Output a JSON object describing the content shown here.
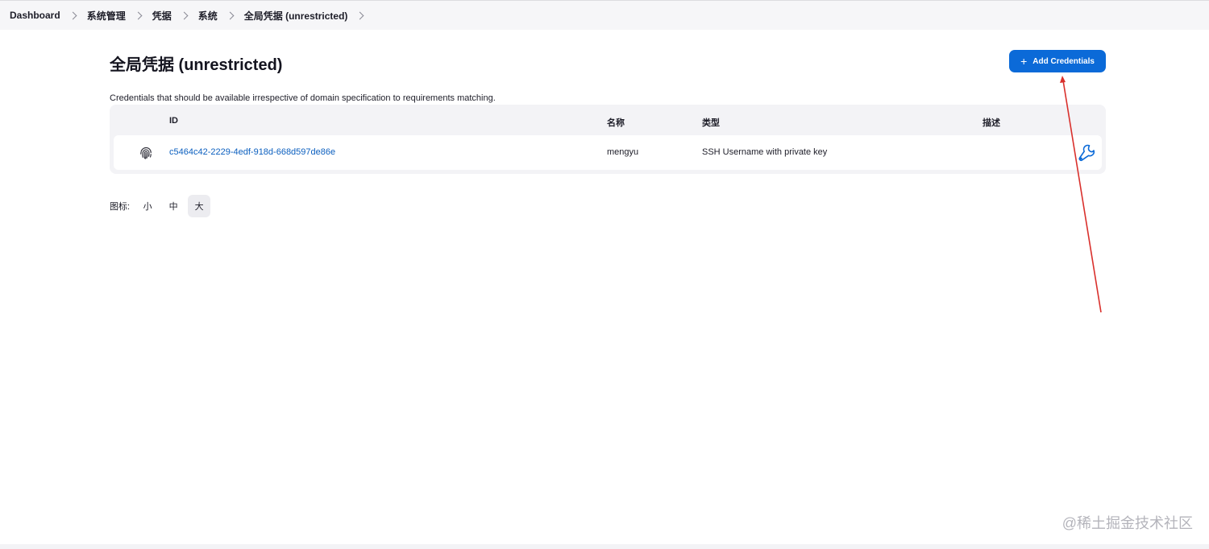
{
  "breadcrumb": [
    "Dashboard",
    "系统管理",
    "凭据",
    "系统",
    "全局凭据 (unrestricted)"
  ],
  "page": {
    "title": "全局凭据 (unrestricted)",
    "add_button": "Add Credentials",
    "description": "Credentials that should be available irrespective of domain specification to requirements matching."
  },
  "table": {
    "headers": {
      "id": "ID",
      "name": "名称",
      "type": "类型",
      "description": "描述"
    },
    "rows": [
      {
        "id": "c5464c42-2229-4edf-918d-668d597de86e",
        "name": "mengyu",
        "type": "SSH Username with private key",
        "description": ""
      }
    ]
  },
  "icon_size": {
    "label": "图标:",
    "options": [
      "小",
      "中",
      "大"
    ],
    "selected": "大"
  },
  "icons": {
    "row_icon": "fingerprint-icon",
    "configure": "wrench-icon",
    "add": "plus-icon"
  },
  "colors": {
    "accent": "#0b6ad8",
    "link": "#0b5fbf",
    "annotation_arrow": "#d9302c"
  },
  "watermark": "@稀土掘金技术社区"
}
